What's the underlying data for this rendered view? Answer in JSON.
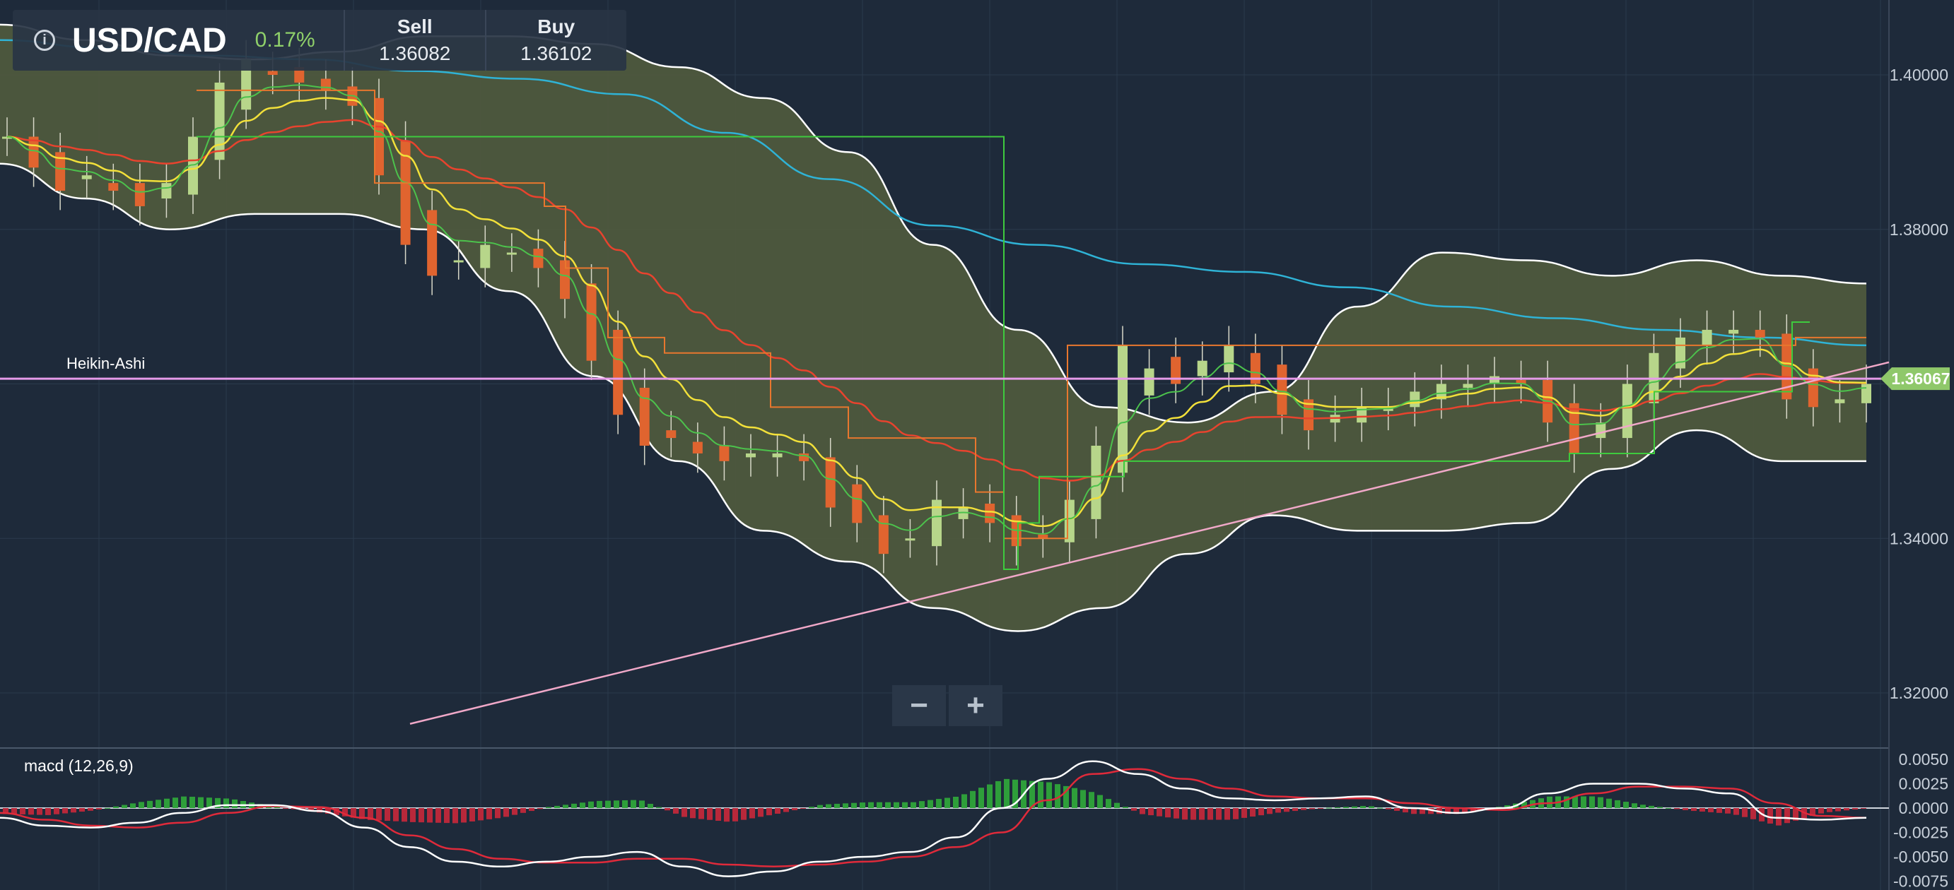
{
  "header": {
    "symbol": "USD/CAD",
    "change": "0.17%",
    "sell_label": "Sell",
    "sell_value": "1.36082",
    "buy_label": "Buy",
    "buy_value": "1.36102",
    "info_icon": "info-icon"
  },
  "zoom": {
    "minus": "−",
    "plus": "+"
  },
  "chart_data": [
    {
      "type": "candlestick",
      "title": "",
      "series_label": "Heikin-Ashi",
      "ylim": [
        1.3135,
        1.4105
      ],
      "y_ticks": [
        "1.40000",
        "1.38000",
        "1.36000",
        "1.34000",
        "1.32000"
      ],
      "last_price": "1.36067",
      "grid": true,
      "candle_closes": [
        1.392,
        1.388,
        1.385,
        1.387,
        1.385,
        1.383,
        1.386,
        1.392,
        1.399,
        1.402,
        1.4,
        1.399,
        1.398,
        1.396,
        1.387,
        1.378,
        1.374,
        1.376,
        1.378,
        1.377,
        1.375,
        1.371,
        1.363,
        1.356,
        1.352,
        1.353,
        1.351,
        1.35,
        1.351,
        1.351,
        1.35,
        1.344,
        1.342,
        1.338,
        1.34,
        1.345,
        1.344,
        1.342,
        1.339,
        1.34,
        1.345,
        1.352,
        1.365,
        1.362,
        1.36,
        1.363,
        1.365,
        1.36,
        1.356,
        1.354,
        1.356,
        1.357,
        1.357,
        1.359,
        1.36,
        1.36,
        1.361,
        1.36,
        1.355,
        1.351,
        1.355,
        1.36,
        1.364,
        1.366,
        1.367,
        1.367,
        1.366,
        1.358,
        1.357,
        1.358,
        1.36
      ],
      "indicators": {
        "bollinger_upper": [
          1.4065,
          1.4045,
          1.4025,
          1.402,
          1.403,
          1.405,
          1.405,
          1.404,
          1.401,
          1.397,
          1.39,
          1.378,
          1.367,
          1.357,
          1.355,
          1.359,
          1.37,
          1.377,
          1.376,
          1.374,
          1.376,
          1.374,
          1.373
        ],
        "bollinger_lower": [
          1.3885,
          1.384,
          1.38,
          1.382,
          1.382,
          1.38,
          1.372,
          1.361,
          1.35,
          1.341,
          1.337,
          1.331,
          1.328,
          1.331,
          1.338,
          1.343,
          1.341,
          1.341,
          1.342,
          1.349,
          1.354,
          1.35,
          1.35
        ],
        "sma_long": [
          1.4045,
          1.4035,
          1.4025,
          1.402,
          1.4005,
          1.3995,
          1.3975,
          1.3925,
          1.3865,
          1.3805,
          1.378,
          1.3755,
          1.3745,
          1.3725,
          1.37,
          1.3685,
          1.367,
          1.366,
          1.365
        ]
      }
    },
    {
      "type": "histogram+line",
      "title": "macd (12,26,9)",
      "ylim": [
        -0.0075,
        0.0055
      ],
      "y_ticks": [
        "0.0050",
        "0.0025",
        "0.0000",
        "-0.0025",
        "-0.0050",
        "-0.0075"
      ],
      "macd": [
        -0.001,
        -0.0018,
        -0.002,
        -0.0015,
        -0.0005,
        0.0003,
        0.0003,
        -0.0003,
        -0.002,
        -0.004,
        -0.0055,
        -0.006,
        -0.0055,
        -0.005,
        -0.0045,
        -0.006,
        -0.007,
        -0.0065,
        -0.0055,
        -0.005,
        -0.0045,
        -0.003,
        0.0,
        0.003,
        0.0048,
        0.0035,
        0.002,
        0.001,
        0.0008,
        0.001,
        0.0012,
        0.0,
        -0.0005,
        0.0,
        0.0015,
        0.0025,
        0.0025,
        0.002,
        0.0015,
        -0.001,
        -0.0012,
        -0.001
      ],
      "signal": [
        -0.0005,
        -0.0012,
        -0.0018,
        -0.002,
        -0.0015,
        -0.0005,
        0.0002,
        0.0001,
        -0.001,
        -0.0028,
        -0.0042,
        -0.0052,
        -0.0056,
        -0.0056,
        -0.0052,
        -0.0052,
        -0.0058,
        -0.006,
        -0.0058,
        -0.0055,
        -0.005,
        -0.004,
        -0.0025,
        0.0008,
        0.0035,
        0.004,
        0.003,
        0.002,
        0.0012,
        0.001,
        0.001,
        0.0005,
        0.0,
        -0.0002,
        0.0005,
        0.0015,
        0.0022,
        0.0022,
        0.002,
        0.0005,
        -0.0008,
        -0.001
      ]
    }
  ]
}
